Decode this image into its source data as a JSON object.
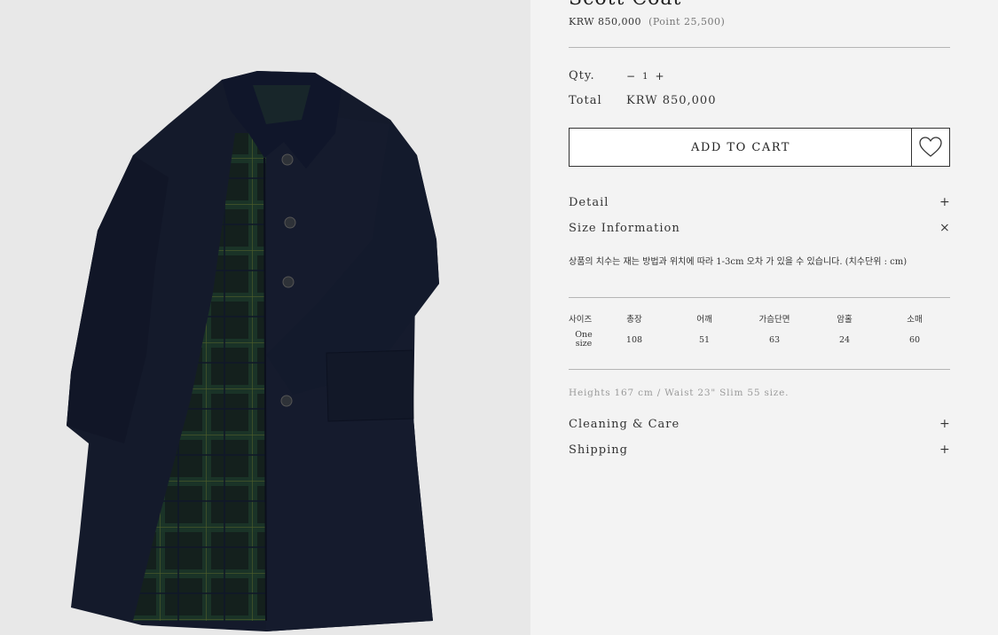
{
  "product": {
    "title": "Scott Coat",
    "price": "KRW 850,000",
    "point": "(Point 25,500)"
  },
  "quantity": {
    "label": "Qty.",
    "minus": "−",
    "value": "1",
    "plus": "+"
  },
  "total": {
    "label": "Total",
    "value": "KRW 850,000"
  },
  "cart": {
    "button_label": "ADD TO CART",
    "wishlist_icon": "heart-icon"
  },
  "accordion": {
    "detail": {
      "label": "Detail",
      "icon": "+"
    },
    "size_info": {
      "label": "Size Information",
      "icon": "×"
    },
    "cleaning": {
      "label": "Cleaning & Care",
      "icon": "+"
    },
    "shipping": {
      "label": "Shipping",
      "icon": "+"
    }
  },
  "size_info": {
    "note": "상품의 치수는 재는 방법과 위치에 따라 1-3cm 오차 가 있을 수 있습니다. (치수단위 : cm)",
    "headers": [
      "사이즈",
      "총장",
      "어깨",
      "가슴단면",
      "암홀",
      "소매"
    ],
    "rows": [
      {
        "size_line1": "One",
        "size_line2": "size",
        "values": [
          "108",
          "51",
          "63",
          "24",
          "60"
        ]
      }
    ],
    "model_info": "Heights 167 cm / Waist 23\" Slim 55 size."
  },
  "colors": {
    "coat_navy": "#151a2c",
    "lining_green": "#1f3a2c",
    "panel_bg": "#f3f3f3",
    "image_bg": "#e8e8e8"
  }
}
